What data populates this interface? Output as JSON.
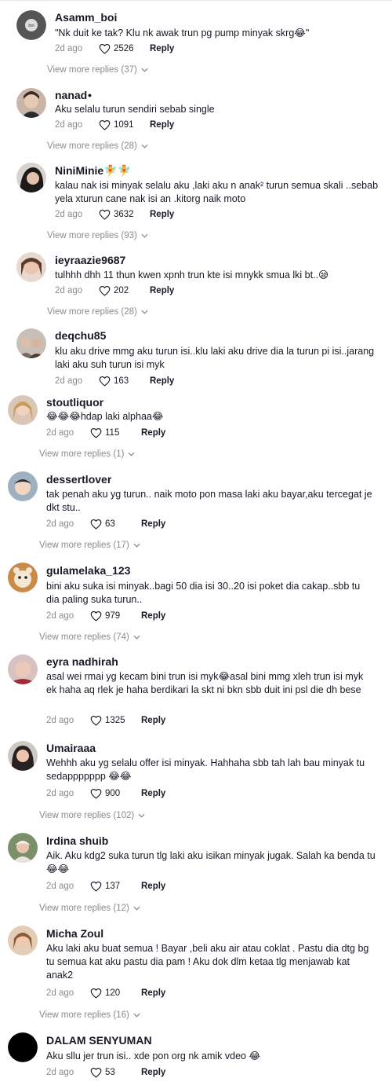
{
  "colors": {
    "text": "#161823",
    "muted": "#8a8b91",
    "background": "#ffffff"
  },
  "comments": [
    {
      "username": "Asamm_boi",
      "text": "\"Nk duit ke tak? Klu nk awak trun pg pump minyak skrg😂\"",
      "date": "2d ago",
      "likes": "2526",
      "reply": "Reply",
      "more": "View more replies (37)",
      "avatar_icon": "avatar-logo-icon"
    },
    {
      "username": "nanad",
      "badge": "•",
      "text": "Aku selalu turun sendiri sebab single",
      "date": "2d ago",
      "likes": "1091",
      "reply": "Reply",
      "more": "View more replies (28)",
      "avatar_icon": "avatar-photo-icon"
    },
    {
      "username": "NiniMinie🧚🧚",
      "text": "kalau nak isi minyak selalu aku ,laki aku n anak² turun semua skali ..sebab yela xturun cane nak isi an .kitorg naik moto",
      "date": "2d ago",
      "likes": "3632",
      "reply": "Reply",
      "more": "View more replies (93)",
      "avatar_icon": "avatar-photo-icon"
    },
    {
      "username": "ieyraazie9687",
      "text": "tulhhh dhh 11 thun kwen xpnh trun kte isi mnykk smua lki bt..😪",
      "date": "2d ago",
      "likes": "202",
      "reply": "Reply",
      "more": "View more replies (28)",
      "avatar_icon": "avatar-photo-icon"
    },
    {
      "username": "deqchu85",
      "text": "klu aku drive mmg aku turun isi..klu laki aku drive dia la turun pi isi..jarang laki aku suh turun isi myk",
      "date": "2d ago",
      "likes": "163",
      "reply": "Reply",
      "more": "",
      "avatar_icon": "avatar-photo-icon"
    },
    {
      "username": "stoutliquor",
      "text": "😂😂😂hdap laki alphaa😂",
      "date": "2d ago",
      "likes": "115",
      "reply": "Reply",
      "more": "View more replies (1)",
      "avatar_icon": "avatar-photo-icon"
    },
    {
      "username": "dessertlover",
      "text": "tak penah aku yg turun.. naik moto pon masa laki aku bayar,aku tercegat je dkt stu..",
      "date": "2d ago",
      "likes": "63",
      "reply": "Reply",
      "more": "View more replies (17)",
      "avatar_icon": "avatar-photo-icon"
    },
    {
      "username": "gulamelaka_123",
      "text": "bini aku suka isi minyak..bagi 50 dia isi 30..20 isi poket dia cakap..sbb tu dia paling suka turun..",
      "date": "2d ago",
      "likes": "979",
      "reply": "Reply",
      "more": "View more replies (74)",
      "avatar_icon": "avatar-photo-icon"
    },
    {
      "username": "eyra nadhirah",
      "text": "asal wei rmai yg kecam bini trun isi myk😂asal bini mmg xleh trun isi myk ek haha aq rlek je haha berdikari la skt ni bkn sbb duit ini psl die dh bese",
      "date": "2d ago",
      "likes": "1325",
      "reply": "Reply",
      "more": "",
      "avatar_icon": "avatar-photo-icon"
    },
    {
      "username": "Umairaaa",
      "text": "Wehhh aku yg selalu offer isi minyak. Hahhaha sbb tah lah bau minyak tu sedappppppp 😂😂",
      "date": "2d ago",
      "likes": "900",
      "reply": "Reply",
      "more": "View more replies (102)",
      "avatar_icon": "avatar-photo-icon"
    },
    {
      "username": "Irdina shuib",
      "text": "Aik. Aku kdg2 suka turun tlg laki aku isikan minyak jugak. Salah ka benda tu 😂😂",
      "date": "2d ago",
      "likes": "137",
      "reply": "Reply",
      "more": "View more replies (12)",
      "avatar_icon": "avatar-photo-icon"
    },
    {
      "username": "Micha Zoul",
      "text": "Aku laki aku buat semua ! Bayar ,beli aku air atau coklat . Pastu dia dtg bg tu semua kat aku pastu dia pam ! Aku dok dlm ketaa tlg menjawab kat anak2",
      "date": "2d ago",
      "likes": "120",
      "reply": "Reply",
      "more": "View more replies (16)",
      "avatar_icon": "avatar-photo-icon"
    },
    {
      "username": "DALAM SENYUMAN",
      "text": "Aku sllu jer trun isi.. xde pon org nk amik vdeo 😂",
      "date": "2d ago",
      "likes": "53",
      "reply": "Reply",
      "more": "",
      "avatar_icon": "avatar-blank-icon"
    }
  ]
}
